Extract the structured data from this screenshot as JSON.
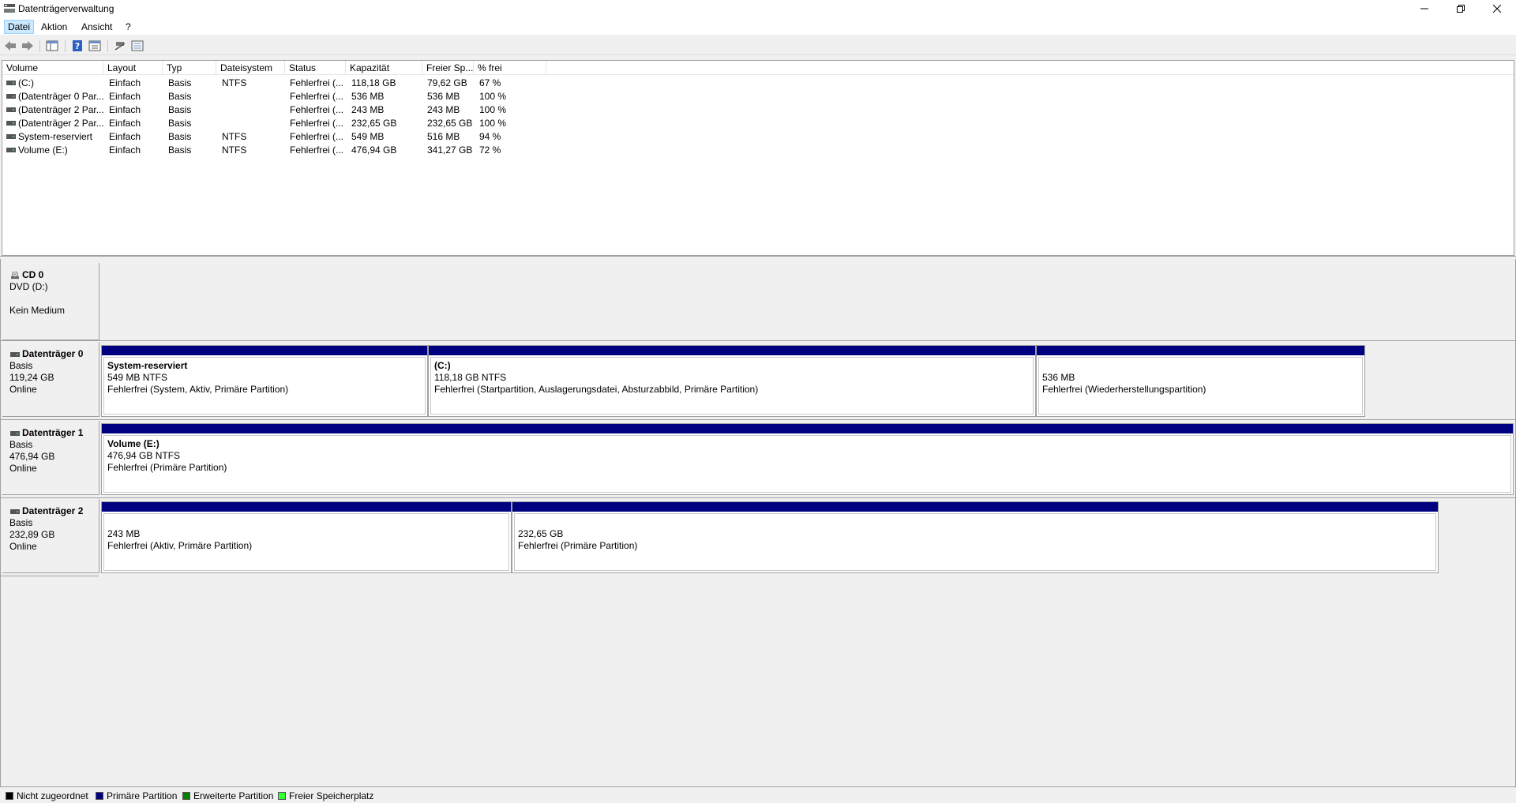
{
  "window": {
    "title": "Datenträgerverwaltung"
  },
  "menu": {
    "datei": "Datei",
    "aktion": "Aktion",
    "ansicht": "Ansicht",
    "help": "?"
  },
  "volume_table": {
    "columns": [
      "Volume",
      "Layout",
      "Typ",
      "Dateisystem",
      "Status",
      "Kapazität",
      "Freier Sp...",
      "% frei"
    ],
    "rows": [
      [
        "(C:)",
        "Einfach",
        "Basis",
        "NTFS",
        "Fehlerfrei (...",
        "118,18 GB",
        "79,62 GB",
        "67 %"
      ],
      [
        "(Datenträger 0 Par...",
        "Einfach",
        "Basis",
        "",
        "Fehlerfrei (...",
        "536 MB",
        "536 MB",
        "100 %"
      ],
      [
        "(Datenträger 2 Par...",
        "Einfach",
        "Basis",
        "",
        "Fehlerfrei (...",
        "243 MB",
        "243 MB",
        "100 %"
      ],
      [
        "(Datenträger 2 Par...",
        "Einfach",
        "Basis",
        "",
        "Fehlerfrei (...",
        "232,65 GB",
        "232,65 GB",
        "100 %"
      ],
      [
        "System-reserviert",
        "Einfach",
        "Basis",
        "NTFS",
        "Fehlerfrei (...",
        "549 MB",
        "516 MB",
        "94 %"
      ],
      [
        "Volume (E:)",
        "Einfach",
        "Basis",
        "NTFS",
        "Fehlerfrei (...",
        "476,94 GB",
        "341,27 GB",
        "72 %"
      ]
    ]
  },
  "disks": {
    "cd0": {
      "name": "CD 0",
      "line1": "DVD (D:)",
      "line2": "",
      "line3": "Kein Medium"
    },
    "disk0": {
      "name": "Datenträger 0",
      "type": "Basis",
      "size": "119,24 GB",
      "state": "Online",
      "partitions": [
        {
          "name": "System-reserviert",
          "size": "549 MB NTFS",
          "status": "Fehlerfrei (System, Aktiv, Primäre Partition)"
        },
        {
          "name": "(C:)",
          "size": "118,18 GB NTFS",
          "status": "Fehlerfrei (Startpartition, Auslagerungsdatei, Absturzabbild, Primäre Partition)"
        },
        {
          "name": "",
          "size": "536 MB",
          "status": "Fehlerfrei (Wiederherstellungspartition)"
        }
      ]
    },
    "disk1": {
      "name": "Datenträger 1",
      "type": "Basis",
      "size": "476,94 GB",
      "state": "Online",
      "partitions": [
        {
          "name": "Volume  (E:)",
          "size": "476,94 GB NTFS",
          "status": "Fehlerfrei (Primäre Partition)"
        }
      ]
    },
    "disk2": {
      "name": "Datenträger 2",
      "type": "Basis",
      "size": "232,89 GB",
      "state": "Online",
      "partitions": [
        {
          "name": "",
          "size": "243 MB",
          "status": "Fehlerfrei (Aktiv, Primäre Partition)"
        },
        {
          "name": "",
          "size": "232,65 GB",
          "status": "Fehlerfrei (Primäre Partition)"
        }
      ]
    }
  },
  "legend": {
    "items": [
      {
        "label": "Nicht zugeordnet",
        "color": "#000000"
      },
      {
        "label": "Primäre Partition",
        "color": "#000080"
      },
      {
        "label": "Erweiterte Partition",
        "color": "#008000"
      },
      {
        "label": "Freier Speicherplatz",
        "color": "#33ff33"
      }
    ]
  },
  "colors": {
    "primary_partition": "#000080",
    "menu_highlight": "#cce8ff"
  },
  "icons": [
    "app-icon",
    "back-arrow-icon",
    "forward-arrow-icon",
    "console-tree-icon",
    "help-icon",
    "properties-icon",
    "connect-icon",
    "list-view-icon",
    "disk-icon",
    "cd-icon"
  ]
}
